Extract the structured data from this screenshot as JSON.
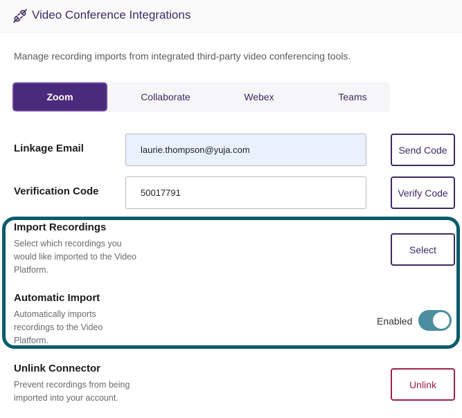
{
  "header": {
    "title": "Video Conference Integrations",
    "icon": "plug-link-icon"
  },
  "description": "Manage recording imports from integrated third-party video conferencing tools.",
  "tabs": [
    {
      "label": "Zoom",
      "active": true
    },
    {
      "label": "Collaborate",
      "active": false
    },
    {
      "label": "Webex",
      "active": false
    },
    {
      "label": "Teams",
      "active": false
    }
  ],
  "linkage": {
    "label": "Linkage Email",
    "value": "laurie.thompson@yuja.com",
    "button": "Send Code"
  },
  "verification": {
    "label": "Verification Code",
    "value": "50017791",
    "button": "Verify Code"
  },
  "import_recordings": {
    "label": "Import Recordings",
    "description": "Select which recordings you would like imported to the Video Platform.",
    "button": "Select"
  },
  "automatic_import": {
    "label": "Automatic Import",
    "description": "Automatically imports recordings to the Video Platform.",
    "status": "Enabled",
    "enabled": true
  },
  "unlink": {
    "label": "Unlink Connector",
    "description": "Prevent recordings from being imported into your account.",
    "button": "Unlink"
  },
  "colors": {
    "accent": "#4a2a7a",
    "highlight": "#0b5c6b",
    "danger": "#a0204a",
    "toggle": "#4a8e9e"
  }
}
